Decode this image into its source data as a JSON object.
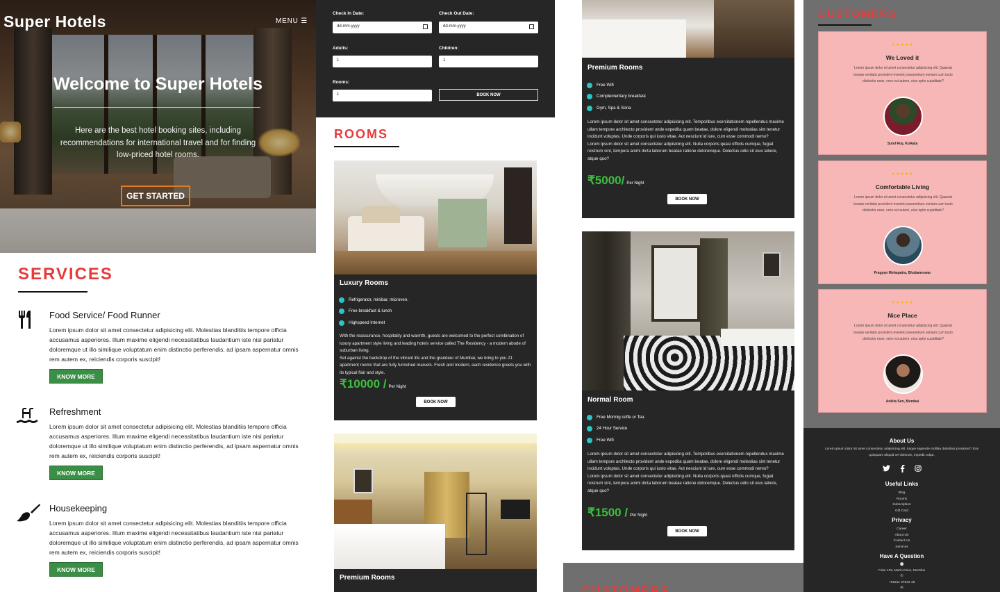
{
  "hero": {
    "brand": "Super Hotels",
    "menu": "MENU ☰",
    "heading": "Welcome to Super Hotels",
    "subtext": "Here are the best hotel booking sites, including recommendations for international travel and for finding low-priced hotel rooms.",
    "cta": "GET STARTED"
  },
  "services": {
    "title": "SERVICES",
    "items": [
      {
        "icon": "fork-knife-icon",
        "title": "Food Service/ Food Runner",
        "text": "Lorem ipsum dolor sit amet consectetur adipisicing elit. Molestias blanditiis tempore officia accusamus asperiores. Illum maxime eligendi necessitatibus laudantium iste nisi pariatur doloremque ut illo similique voluptatum enim distinctio perferendis, ad ipsam aspernatur omnis rem autem ex, reiciendis corporis suscipit!",
        "button": "KNOW MORE"
      },
      {
        "icon": "pool-icon",
        "title": "Refreshment",
        "text": "Lorem ipsum dolor sit amet consectetur adipisicing elit. Molestias blanditiis tempore officia accusamus asperiores. Illum maxime eligendi necessitatibus laudantium iste nisi pariatur doloremque ut illo similique voluptatum enim distinctio perferendis, ad ipsam aspernatur omnis rem autem ex, reiciendis corporis suscipit!",
        "button": "KNOW MORE"
      },
      {
        "icon": "broom-icon",
        "title": "Housekeeping",
        "text": "Lorem ipsum dolor sit amet consectetur adipisicing elit. Molestias blanditiis tempore officia accusamus asperiores. Illum maxime eligendi necessitatibus laudantium iste nisi pariatur doloremque ut illo similique voluptatum enim distinctio perferendis, ad ipsam aspernatur omnis rem autem ex, reiciendis corporis suscipit!",
        "button": "KNOW MORE"
      }
    ]
  },
  "booking": {
    "checkin_label": "Check  In  Date:",
    "checkout_label": "Check  Out  Date:",
    "date_placeholder": "dd-mm-yyyy",
    "adults_label": "Adults:",
    "children_label": "Children:",
    "rooms_label": "Rooms:",
    "adults_value": "1",
    "children_value": "1",
    "rooms_value": "1",
    "button": "BOOK NOW"
  },
  "rooms": {
    "title": "ROOMS",
    "luxury": {
      "name": "Luxury Rooms",
      "features": [
        "Refrigerator, minibar, microven.",
        "Free breakfast & lunch",
        "Highspeed Internet"
      ],
      "desc": "With the reassurance, hospitality and warmth, guests are welcomed to the perfect combination of luxury apartment style living and leading hotels service called The Residency - a modern abode of suburban living.\nSet against the backdrop of the vibrant life and the grandeur of Mumbai, we bring to you 21 apartment rooms that are fully furnished marvels. Fresh and modern, each residence greets you with its typical flair and style.",
      "price": "₹10000 /",
      "per": "Per Night",
      "button": "BOOK NOW"
    },
    "premium_bottom": {
      "name": "Premium Rooms"
    },
    "premium": {
      "name": "Premium Rooms",
      "features": [
        "Free Wifi",
        "Complementary breakfast",
        "Gym, Spa & Sona"
      ],
      "desc": "Lorem ipsum dolor sit amet consectetur adipisicing elit. Temporibus exercitationem repellendus maxime ullam tempore architecto provident unde expedita quam beatae, dolore eligendi molestias sint tenetur incidunt voluptas. Unde corporis qui iusto vitae. Aut nesciunt id iure, cum esse commodi nemo?\nLorem ipsum dolor sit amet consectetur adipisicing elit. Nulla corporis quasi officiis cumque, fugiat nostrum sint, tempora animi dicta laborum beatae ratione doloremque. Delectus odio sit eius labore, atque quo?",
      "price": "₹5000/",
      "per": "Per Night",
      "button": "BOOK NOW"
    },
    "normal": {
      "name": "Normal Room",
      "features": [
        "Free Morinig coffe or Tea",
        "24 Hour Service",
        "Free Wifi"
      ],
      "desc": "Lorem ipsum dolor sit amet consectetur adipisicing elit. Temporibus exercitationem repellendus maxime ullam tempore architecto provident unde expedita quam beatae, dolore eligendi molestias sint tenetur incidunt voluptas. Unde corporis qui iusto vitae. Aut nesciunt id iure, cum esse commodi nemo?\nLorem ipsum dolor sit amet consectetur adipisicing elit. Nulla corporis quasi officiis cumque, fugiat nostrum sint, tempora animi dicta laborum beatae ratione doloremque. Delectus odio sit eius labore, atque quo?",
      "price": "₹1500 /",
      "per": "Per Night",
      "button": "BOOK NOW"
    }
  },
  "customers": {
    "title": "CUSTOMERS",
    "stars": "★★★★★",
    "text": "Lorem ipsum dolor sit amet consectetur adipisicing elit. Quaerat beatae veritatis provident eveniet praesentium veniam cum iusto distinctio esse, vero est autem, eius optio cupiditate?",
    "reviews": [
      {
        "title": "We Loved it",
        "name": "Sunil Roy, Kolkata"
      },
      {
        "title": "Comfortable Living",
        "name": "Pragyan Mohapatra, Bhubaneswar"
      },
      {
        "title": "Nice Place",
        "name": "Ankita Sen, Mumbai"
      }
    ]
  },
  "footer": {
    "about_title": "About Us",
    "about_text": "Lorem ipsum dolor sit amet consectetur adipisicing elit. Itaque sapiente mollitia doloribus provident? Eos quisquam aliquid vel dolorum, impedit culpa.",
    "useful_title": "Useful Links",
    "useful_links": [
      "Blog",
      "Rooms",
      "Subscription",
      "Gift Card"
    ],
    "privacy_title": "Privacy",
    "privacy_links": [
      "Career",
      "About Us",
      "Contact Us",
      "Services"
    ],
    "question_title": "Have A Question",
    "address": "Fake 102, Marin Drive, Mumbai",
    "phone": "+91541 37534 48"
  }
}
